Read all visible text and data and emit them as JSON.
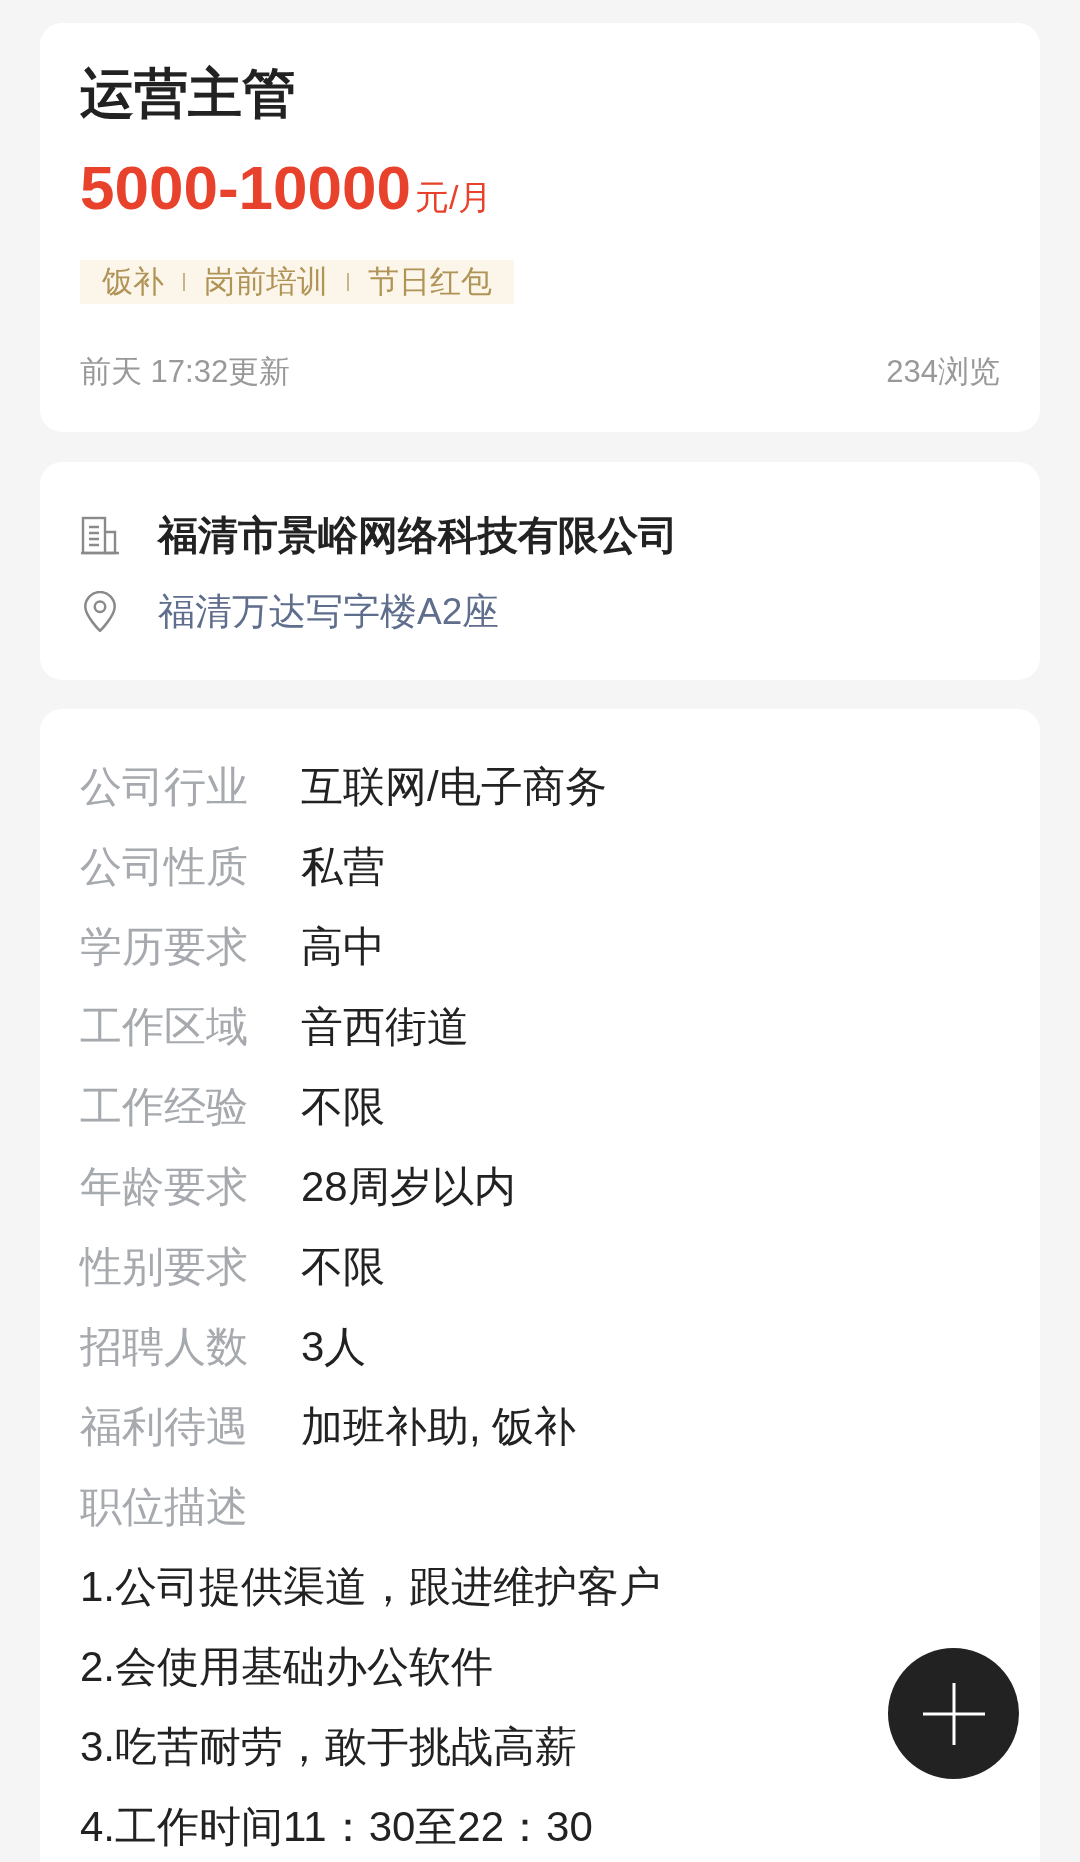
{
  "job": {
    "title": "运营主管",
    "salary": {
      "amount": "5000-10000",
      "unit": "元/月"
    },
    "tags": [
      "饭补",
      "岗前培训",
      "节日红包"
    ],
    "updated": "前天 17:32更新",
    "views": "234浏览"
  },
  "company": {
    "name": "福清市景峪网络科技有限公司",
    "address": "福清万达写字楼A2座"
  },
  "details": {
    "fields": [
      {
        "label": "公司行业",
        "value": "互联网/电子商务"
      },
      {
        "label": "公司性质",
        "value": "私营"
      },
      {
        "label": "学历要求",
        "value": "高中"
      },
      {
        "label": "工作区域",
        "value": "音西街道"
      },
      {
        "label": "工作经验",
        "value": "不限"
      },
      {
        "label": "年龄要求",
        "value": "28周岁以内"
      },
      {
        "label": "性别要求",
        "value": "不限"
      },
      {
        "label": "招聘人数",
        "value": "3人"
      },
      {
        "label": "福利待遇",
        "value": "加班补助, 饭补"
      }
    ],
    "description_label": "职位描述",
    "description": [
      "1.公司提供渠道，跟进维护客户",
      "2.会使用基础办公软件",
      "3.吃苦耐劳，敢于挑战高薪",
      "4.工作时间11：30至22：30"
    ]
  }
}
